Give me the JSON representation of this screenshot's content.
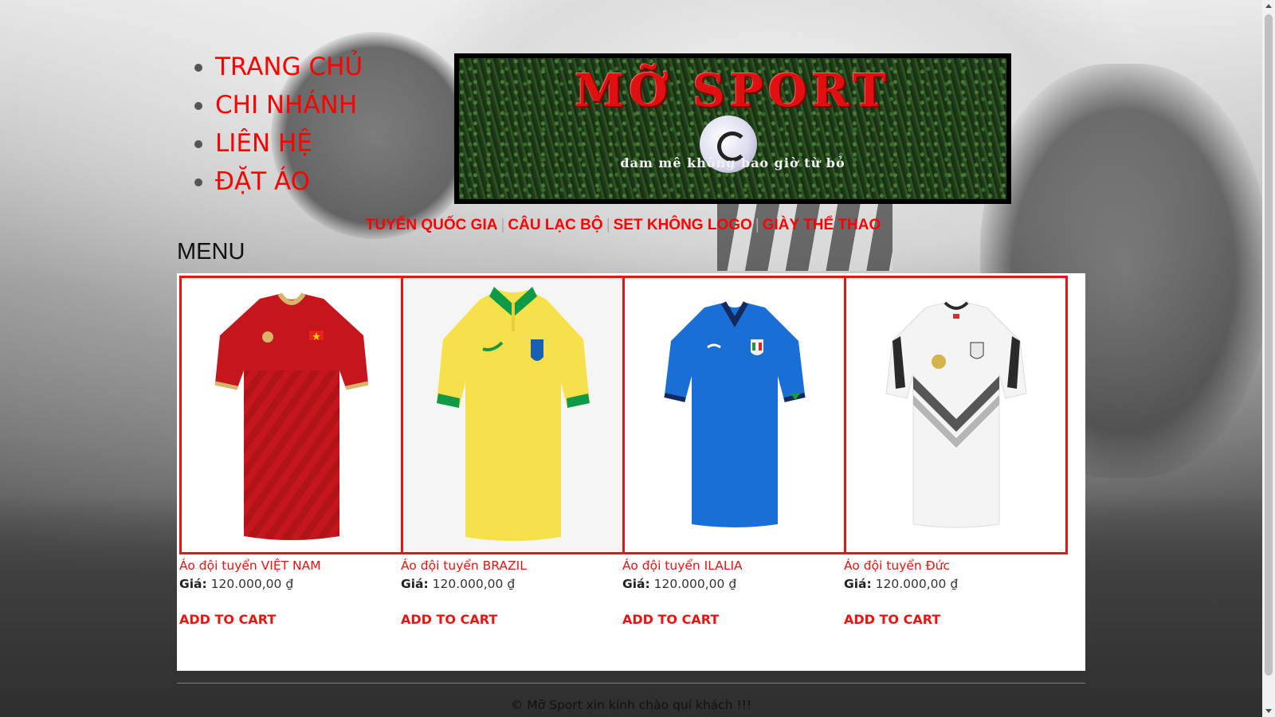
{
  "top_nav": {
    "items": [
      {
        "label": "TRANG CHỦ"
      },
      {
        "label": "CHI NHÁNH"
      },
      {
        "label": "LIÊN HỆ"
      },
      {
        "label": "ĐẶT ÁO"
      }
    ]
  },
  "banner": {
    "title": "MỠ SPORT",
    "slogan": "đam mê không bao giờ từ bỏ"
  },
  "category_nav": {
    "items": [
      {
        "label": "TUYỂN QUỐC GIA"
      },
      {
        "label": "CÂU LẠC BỘ"
      },
      {
        "label": "SET KHÔNG LOGO"
      },
      {
        "label": "GIÀY THỂ THAO"
      }
    ],
    "separator": "|"
  },
  "menu": {
    "heading": "MENU"
  },
  "products": [
    {
      "name": "Áo đội tuyển VIỆT NAM",
      "price_label": "Giá:",
      "price": "120.000,00 ₫",
      "cta": "ADD TO CART",
      "image_icon": "vietnam-jersey-image",
      "primary_color": "#c4161c",
      "trim_color": "#d8b36a"
    },
    {
      "name": "Áo đội tuyển BRAZIL",
      "price_label": "Giá:",
      "price": "120.000,00 ₫",
      "cta": "ADD TO CART",
      "image_icon": "brazil-jersey-image",
      "primary_color": "#f7e14a",
      "trim_color": "#0f9a48"
    },
    {
      "name": "Áo đội tuyển ILALIA",
      "price_label": "Giá:",
      "price": "120.000,00 ₫",
      "cta": "ADD TO CART",
      "image_icon": "italy-jersey-image",
      "primary_color": "#1a6fd6",
      "trim_color": "#14295c"
    },
    {
      "name": "Áo đội tuyển Đức",
      "price_label": "Giá:",
      "price": "120.000,00 ₫",
      "cta": "ADD TO CART",
      "image_icon": "germany-jersey-image",
      "primary_color": "#f4f4f4",
      "trim_color": "#2a2a2a"
    }
  ],
  "footer": {
    "text": "© Mỡ Sport xin kính chào quí khách !!!"
  },
  "colors": {
    "accent": "#ff0000",
    "panel_background": "#ffffff"
  }
}
